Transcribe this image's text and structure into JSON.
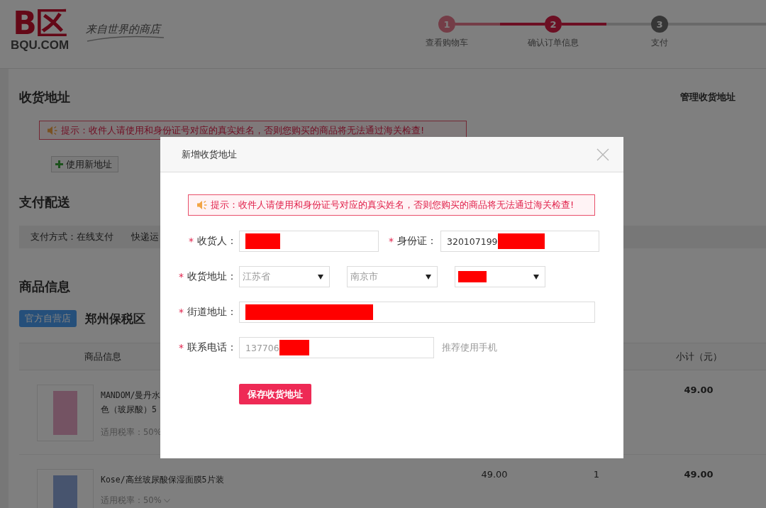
{
  "header": {
    "logo": {
      "mark": "B区",
      "name": "BQU.COM",
      "tagline": "来自世界的商店"
    },
    "steps": [
      {
        "number": "1",
        "label": "查看购物车",
        "done": true,
        "selected": false
      },
      {
        "number": "2",
        "label": "确认订单信息",
        "done": false,
        "selected": true
      },
      {
        "number": "3",
        "label": "支付",
        "done": false,
        "selected": false
      }
    ]
  },
  "address": {
    "title": "收货地址",
    "manage_link": "管理收货地址",
    "notice": "提示：收件人请使用和身份证号对应的真实姓名，否则您购买的商品将无法通过海关检查!",
    "new_address_button": "使用新地址"
  },
  "payment": {
    "title": "支付配送",
    "items": [
      "支付方式：在线支付",
      "快递运"
    ]
  },
  "goods": {
    "title": "商品信息",
    "store_badge": "官方自营店",
    "warehouse": "郑州保税区",
    "columns": {
      "product": "商品信息",
      "subtotal": "小计（元）"
    },
    "rows": [
      {
        "name_lines": [
          "MANDOM/曼丹水",
          "色（玻尿酸）5"
        ],
        "tax": "适用税率：50%",
        "subtotal": "49.00"
      },
      {
        "name_lines": [
          "Kose/高丝玻尿酸保湿面膜5片装"
        ],
        "tax": "适用税率：50%",
        "price": "49.00",
        "quantity": "1",
        "subtotal": "49.00"
      }
    ]
  },
  "modal": {
    "title": "新增收货地址",
    "notice": "提示：收件人请使用和身份证号对应的真实姓名，否则您购买的商品将无法通过海关检查!",
    "form": {
      "rows": [
        {
          "items": [
            {
              "kind": "label",
              "mark": "*",
              "text": "收货人："
            },
            {
              "kind": "input",
              "redacted": true
            },
            {
              "kind": "label",
              "mark": "*",
              "text": "身份证："
            },
            {
              "kind": "input",
              "value": "320107199",
              "redacted": true,
              "muted": false
            }
          ]
        },
        {
          "items": [
            {
              "kind": "label",
              "mark": "*",
              "text": "收货地址："
            },
            {
              "kind": "select",
              "value": "江苏省",
              "redacted": false,
              "muted": true
            },
            {
              "kind": "select",
              "value": "南京市",
              "redacted": false,
              "muted": true
            },
            {
              "kind": "select",
              "redacted": true
            }
          ]
        },
        {
          "items": [
            {
              "kind": "label",
              "mark": "*",
              "text": "街道地址："
            },
            {
              "kind": "input",
              "redacted": true
            }
          ]
        },
        {
          "items": [
            {
              "kind": "label",
              "mark": "*",
              "text": "联系电话："
            },
            {
              "kind": "input",
              "value": "137706",
              "redacted": true,
              "muted": true
            },
            {
              "kind": "hint",
              "text": "推荐使用手机"
            }
          ]
        }
      ]
    },
    "save_button": "保存收货地址"
  }
}
